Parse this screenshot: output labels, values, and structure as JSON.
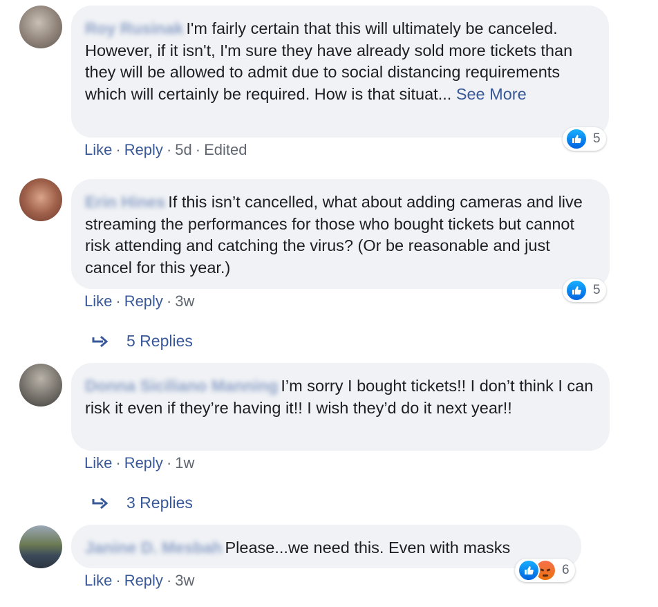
{
  "comments": [
    {
      "author": "Roy Rusinak",
      "text": "I'm fairly certain that this will ultimately be canceled. However, if it isn't, I'm sure they have already sold more tickets than they will be allowed to admit due to social distancing requirements which will certainly be required. How is that situat...",
      "see_more": "See More",
      "like_label": "Like",
      "reply_label": "Reply",
      "time": "5d",
      "edited": "Edited",
      "reactions": {
        "types": [
          "like"
        ],
        "count": "5"
      }
    },
    {
      "author": "Erin Hines",
      "text": "If this isn’t cancelled, what about adding cameras and live streaming the performances for those who bought tickets but cannot risk attending and catching the virus? (Or be reasonable and just cancel for this year.)",
      "like_label": "Like",
      "reply_label": "Reply",
      "time": "3w",
      "reactions": {
        "types": [
          "like"
        ],
        "count": "5"
      },
      "replies_label": "5 Replies"
    },
    {
      "author": "Donna Siciliano Manning",
      "text": "I’m sorry I bought tickets!! I don’t think I can risk it even if they’re having it!! I wish they’d do it next year!!",
      "like_label": "Like",
      "reply_label": "Reply",
      "time": "1w",
      "replies_label": "3 Replies"
    },
    {
      "author": "Janine D. Mesbah",
      "text": "Please...we need this. Even with masks",
      "like_label": "Like",
      "reply_label": "Reply",
      "time": "3w",
      "reactions": {
        "types": [
          "like",
          "angry"
        ],
        "count": "6"
      }
    }
  ],
  "separator": "·",
  "colors": {
    "link": "#385898",
    "meta": "#606770",
    "bubble": "#f0f2f5",
    "like": "#1877f2",
    "angry": "#f0701c"
  },
  "icons": {
    "like": "thumbs-up-icon",
    "angry": "angry-face-icon",
    "reply_arrow": "reply-arrow-icon"
  }
}
